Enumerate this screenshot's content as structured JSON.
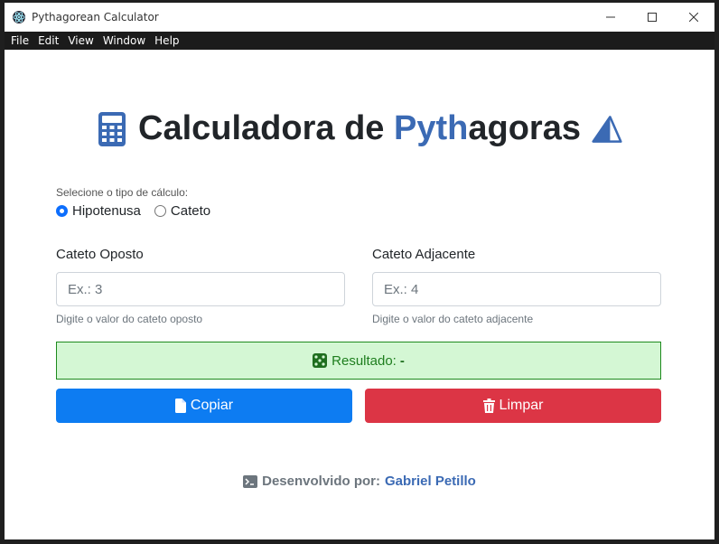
{
  "window": {
    "title": "Pythagorean Calculator",
    "controls": {
      "minimize": "—",
      "maximize": "☐",
      "close": "✕"
    }
  },
  "menubar": {
    "items": [
      "File",
      "Edit",
      "View",
      "Window",
      "Help"
    ]
  },
  "heading": {
    "part1": "Calculadora de ",
    "part2_blue": "Pyth",
    "part3": "agoras"
  },
  "calc_type": {
    "label": "Selecione o tipo de cálculo:",
    "options": [
      {
        "label": "Hipotenusa",
        "checked": true
      },
      {
        "label": "Cateto",
        "checked": false
      }
    ]
  },
  "fields": [
    {
      "label": "Cateto Oposto",
      "placeholder": "Ex.: 3",
      "help": "Digite o valor do cateto oposto"
    },
    {
      "label": "Cateto Adjacente",
      "placeholder": "Ex.: 4",
      "help": "Digite o valor do cateto adjacente"
    }
  ],
  "result": {
    "label": "Resultado:",
    "value": "-"
  },
  "buttons": {
    "copy": "Copiar",
    "clear": "Limpar"
  },
  "footer": {
    "prefix": "Desenvolvido por:",
    "author": "Gabriel Petillo"
  },
  "colors": {
    "accent_blue": "#3b6ab4",
    "copy_btn": "#0d7cf2",
    "clear_btn": "#dc3545",
    "result_bg": "#d4f7d4",
    "result_border": "#1e8a1e"
  },
  "icons": [
    "calculator-icon",
    "triangle-icon",
    "dice-icon",
    "file-icon",
    "trash-icon",
    "terminal-icon"
  ]
}
